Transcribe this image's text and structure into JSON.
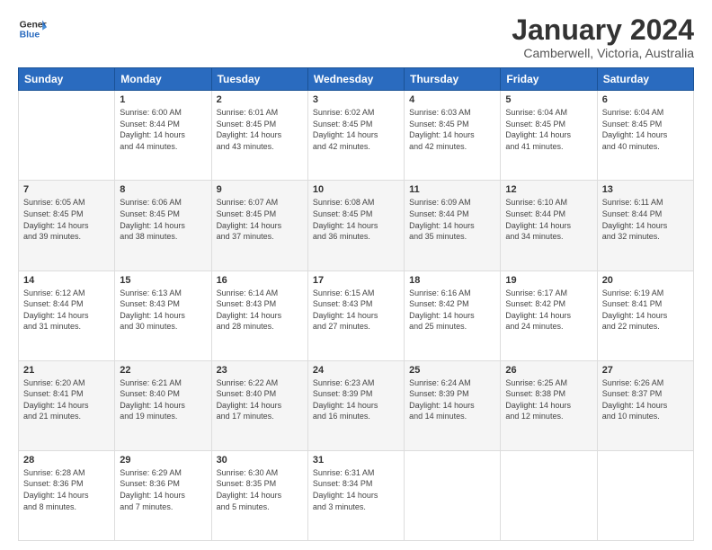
{
  "logo": {
    "line1": "General",
    "line2": "Blue"
  },
  "title": "January 2024",
  "subtitle": "Camberwell, Victoria, Australia",
  "weekdays": [
    "Sunday",
    "Monday",
    "Tuesday",
    "Wednesday",
    "Thursday",
    "Friday",
    "Saturday"
  ],
  "weeks": [
    [
      {
        "day": "",
        "info": ""
      },
      {
        "day": "1",
        "info": "Sunrise: 6:00 AM\nSunset: 8:44 PM\nDaylight: 14 hours\nand 44 minutes."
      },
      {
        "day": "2",
        "info": "Sunrise: 6:01 AM\nSunset: 8:45 PM\nDaylight: 14 hours\nand 43 minutes."
      },
      {
        "day": "3",
        "info": "Sunrise: 6:02 AM\nSunset: 8:45 PM\nDaylight: 14 hours\nand 42 minutes."
      },
      {
        "day": "4",
        "info": "Sunrise: 6:03 AM\nSunset: 8:45 PM\nDaylight: 14 hours\nand 42 minutes."
      },
      {
        "day": "5",
        "info": "Sunrise: 6:04 AM\nSunset: 8:45 PM\nDaylight: 14 hours\nand 41 minutes."
      },
      {
        "day": "6",
        "info": "Sunrise: 6:04 AM\nSunset: 8:45 PM\nDaylight: 14 hours\nand 40 minutes."
      }
    ],
    [
      {
        "day": "7",
        "info": "Sunrise: 6:05 AM\nSunset: 8:45 PM\nDaylight: 14 hours\nand 39 minutes."
      },
      {
        "day": "8",
        "info": "Sunrise: 6:06 AM\nSunset: 8:45 PM\nDaylight: 14 hours\nand 38 minutes."
      },
      {
        "day": "9",
        "info": "Sunrise: 6:07 AM\nSunset: 8:45 PM\nDaylight: 14 hours\nand 37 minutes."
      },
      {
        "day": "10",
        "info": "Sunrise: 6:08 AM\nSunset: 8:45 PM\nDaylight: 14 hours\nand 36 minutes."
      },
      {
        "day": "11",
        "info": "Sunrise: 6:09 AM\nSunset: 8:44 PM\nDaylight: 14 hours\nand 35 minutes."
      },
      {
        "day": "12",
        "info": "Sunrise: 6:10 AM\nSunset: 8:44 PM\nDaylight: 14 hours\nand 34 minutes."
      },
      {
        "day": "13",
        "info": "Sunrise: 6:11 AM\nSunset: 8:44 PM\nDaylight: 14 hours\nand 32 minutes."
      }
    ],
    [
      {
        "day": "14",
        "info": "Sunrise: 6:12 AM\nSunset: 8:44 PM\nDaylight: 14 hours\nand 31 minutes."
      },
      {
        "day": "15",
        "info": "Sunrise: 6:13 AM\nSunset: 8:43 PM\nDaylight: 14 hours\nand 30 minutes."
      },
      {
        "day": "16",
        "info": "Sunrise: 6:14 AM\nSunset: 8:43 PM\nDaylight: 14 hours\nand 28 minutes."
      },
      {
        "day": "17",
        "info": "Sunrise: 6:15 AM\nSunset: 8:43 PM\nDaylight: 14 hours\nand 27 minutes."
      },
      {
        "day": "18",
        "info": "Sunrise: 6:16 AM\nSunset: 8:42 PM\nDaylight: 14 hours\nand 25 minutes."
      },
      {
        "day": "19",
        "info": "Sunrise: 6:17 AM\nSunset: 8:42 PM\nDaylight: 14 hours\nand 24 minutes."
      },
      {
        "day": "20",
        "info": "Sunrise: 6:19 AM\nSunset: 8:41 PM\nDaylight: 14 hours\nand 22 minutes."
      }
    ],
    [
      {
        "day": "21",
        "info": "Sunrise: 6:20 AM\nSunset: 8:41 PM\nDaylight: 14 hours\nand 21 minutes."
      },
      {
        "day": "22",
        "info": "Sunrise: 6:21 AM\nSunset: 8:40 PM\nDaylight: 14 hours\nand 19 minutes."
      },
      {
        "day": "23",
        "info": "Sunrise: 6:22 AM\nSunset: 8:40 PM\nDaylight: 14 hours\nand 17 minutes."
      },
      {
        "day": "24",
        "info": "Sunrise: 6:23 AM\nSunset: 8:39 PM\nDaylight: 14 hours\nand 16 minutes."
      },
      {
        "day": "25",
        "info": "Sunrise: 6:24 AM\nSunset: 8:39 PM\nDaylight: 14 hours\nand 14 minutes."
      },
      {
        "day": "26",
        "info": "Sunrise: 6:25 AM\nSunset: 8:38 PM\nDaylight: 14 hours\nand 12 minutes."
      },
      {
        "day": "27",
        "info": "Sunrise: 6:26 AM\nSunset: 8:37 PM\nDaylight: 14 hours\nand 10 minutes."
      }
    ],
    [
      {
        "day": "28",
        "info": "Sunrise: 6:28 AM\nSunset: 8:36 PM\nDaylight: 14 hours\nand 8 minutes."
      },
      {
        "day": "29",
        "info": "Sunrise: 6:29 AM\nSunset: 8:36 PM\nDaylight: 14 hours\nand 7 minutes."
      },
      {
        "day": "30",
        "info": "Sunrise: 6:30 AM\nSunset: 8:35 PM\nDaylight: 14 hours\nand 5 minutes."
      },
      {
        "day": "31",
        "info": "Sunrise: 6:31 AM\nSunset: 8:34 PM\nDaylight: 14 hours\nand 3 minutes."
      },
      {
        "day": "",
        "info": ""
      },
      {
        "day": "",
        "info": ""
      },
      {
        "day": "",
        "info": ""
      }
    ]
  ]
}
